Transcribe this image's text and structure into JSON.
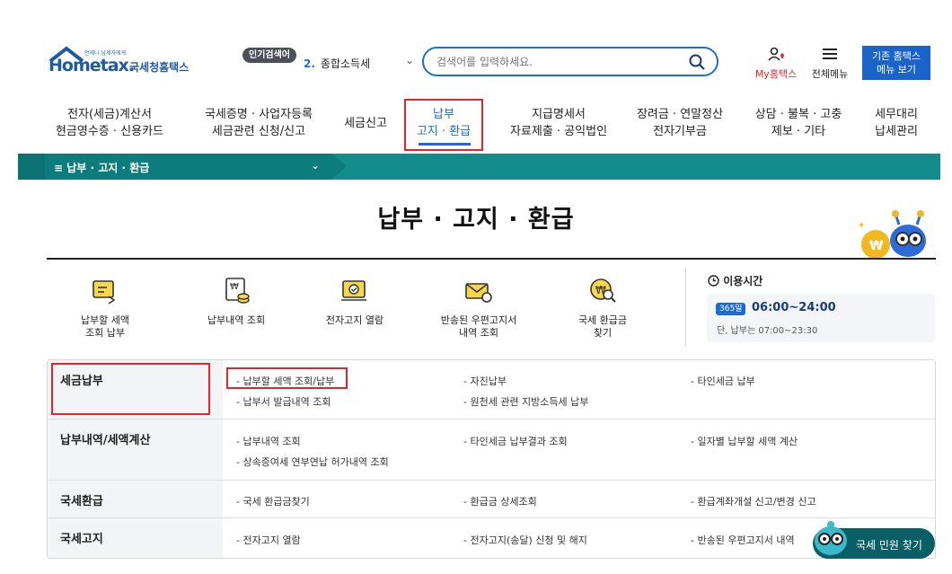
{
  "header": {
    "logo_tagline": "언제나 납세자에게",
    "logo_word": "Hometax.",
    "logo_korean": "국세청홈택스",
    "popular_badge": "인기검색어",
    "popular_rank": "2.",
    "popular_term": "종합소득세",
    "search_placeholder": "검색어를 입력하세요.",
    "my_hometax": "My홈택스",
    "all_menu": "전체메뉴",
    "old_menu_line1": "기존 홈택스",
    "old_menu_line2": "메뉴 보기"
  },
  "gnb": [
    {
      "l1": "전자(세금)계산서",
      "l2": "현금영수증 · 신용카드"
    },
    {
      "l1": "국세증명 · 사업자등록",
      "l2": "세금관련 신청/신고"
    },
    {
      "l1": "세금신고",
      "l2": ""
    },
    {
      "l1": "납부",
      "l2": "고지 · 환급"
    },
    {
      "l1": "지급명세서",
      "l2": "자료제출 · 공익법인"
    },
    {
      "l1": "장려금 · 연말정산",
      "l2": "전자기부금"
    },
    {
      "l1": "상담 · 불복 · 고충",
      "l2": "제보 · 기타"
    },
    {
      "l1": "세무대리",
      "l2": "납세관리"
    }
  ],
  "breadcrumb": {
    "menu_icon": "≡",
    "current": "납부 · 고지 · 환급",
    "chevron": "⌄"
  },
  "page_title": "납부 · 고지 · 환급",
  "quick_links": [
    {
      "l1": "납부할 세액",
      "l2": "조회 납부"
    },
    {
      "l1": "납부내역 조회",
      "l2": ""
    },
    {
      "l1": "전자고지 열람",
      "l2": ""
    },
    {
      "l1": "반송된 우편고지서",
      "l2": "내역 조회"
    },
    {
      "l1": "국세 환급금",
      "l2": "찾기"
    }
  ],
  "hours": {
    "title": "이용시간",
    "badge": "365일",
    "time": "06:00~24:00",
    "sub": "단, 납부는 07:00~23:30"
  },
  "menu": [
    {
      "head": "세금납부",
      "links": [
        "- 납부할 세액 조회/납부",
        "- 자진납부",
        "- 타인세금 납부",
        "- 납부서 발급내역 조회",
        "- 원천세 관련 지방소득세 납부"
      ]
    },
    {
      "head": "납부내역/세액계산",
      "links": [
        "- 납부내역 조회",
        "- 타인세금 납부결과 조회",
        "- 일자별 납부할 세액 계산",
        "- 상속증여세 연부연납 허가내역 조회"
      ]
    },
    {
      "head": "국세환급",
      "links": [
        "- 국세 환급금찾기",
        "- 환급금 상세조회",
        "- 환급계좌개설 신고/변경 신고"
      ]
    },
    {
      "head": "국세고지",
      "links": [
        "- 전자고지 열람",
        "- 전자고지(송달) 신청 및 해지",
        "- 반송된 우편고지서 내역"
      ]
    }
  ],
  "civil_button": "국세 민원 찾기",
  "colors": {
    "brand": "#1f5aa8",
    "accent": "#1c6ad6",
    "teal": "#148c8c",
    "highlight": "#e0252b"
  }
}
